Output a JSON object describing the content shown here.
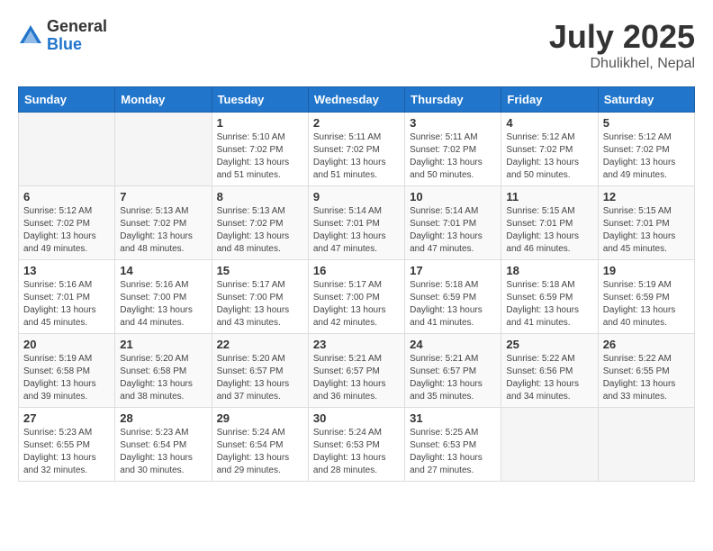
{
  "logo": {
    "general": "General",
    "blue": "Blue"
  },
  "title": "July 2025",
  "location": "Dhulikhel, Nepal",
  "days_header": [
    "Sunday",
    "Monday",
    "Tuesday",
    "Wednesday",
    "Thursday",
    "Friday",
    "Saturday"
  ],
  "weeks": [
    [
      {
        "day": "",
        "sunrise": "",
        "sunset": "",
        "daylight": ""
      },
      {
        "day": "",
        "sunrise": "",
        "sunset": "",
        "daylight": ""
      },
      {
        "day": "1",
        "sunrise": "Sunrise: 5:10 AM",
        "sunset": "Sunset: 7:02 PM",
        "daylight": "Daylight: 13 hours and 51 minutes."
      },
      {
        "day": "2",
        "sunrise": "Sunrise: 5:11 AM",
        "sunset": "Sunset: 7:02 PM",
        "daylight": "Daylight: 13 hours and 51 minutes."
      },
      {
        "day": "3",
        "sunrise": "Sunrise: 5:11 AM",
        "sunset": "Sunset: 7:02 PM",
        "daylight": "Daylight: 13 hours and 50 minutes."
      },
      {
        "day": "4",
        "sunrise": "Sunrise: 5:12 AM",
        "sunset": "Sunset: 7:02 PM",
        "daylight": "Daylight: 13 hours and 50 minutes."
      },
      {
        "day": "5",
        "sunrise": "Sunrise: 5:12 AM",
        "sunset": "Sunset: 7:02 PM",
        "daylight": "Daylight: 13 hours and 49 minutes."
      }
    ],
    [
      {
        "day": "6",
        "sunrise": "Sunrise: 5:12 AM",
        "sunset": "Sunset: 7:02 PM",
        "daylight": "Daylight: 13 hours and 49 minutes."
      },
      {
        "day": "7",
        "sunrise": "Sunrise: 5:13 AM",
        "sunset": "Sunset: 7:02 PM",
        "daylight": "Daylight: 13 hours and 48 minutes."
      },
      {
        "day": "8",
        "sunrise": "Sunrise: 5:13 AM",
        "sunset": "Sunset: 7:02 PM",
        "daylight": "Daylight: 13 hours and 48 minutes."
      },
      {
        "day": "9",
        "sunrise": "Sunrise: 5:14 AM",
        "sunset": "Sunset: 7:01 PM",
        "daylight": "Daylight: 13 hours and 47 minutes."
      },
      {
        "day": "10",
        "sunrise": "Sunrise: 5:14 AM",
        "sunset": "Sunset: 7:01 PM",
        "daylight": "Daylight: 13 hours and 47 minutes."
      },
      {
        "day": "11",
        "sunrise": "Sunrise: 5:15 AM",
        "sunset": "Sunset: 7:01 PM",
        "daylight": "Daylight: 13 hours and 46 minutes."
      },
      {
        "day": "12",
        "sunrise": "Sunrise: 5:15 AM",
        "sunset": "Sunset: 7:01 PM",
        "daylight": "Daylight: 13 hours and 45 minutes."
      }
    ],
    [
      {
        "day": "13",
        "sunrise": "Sunrise: 5:16 AM",
        "sunset": "Sunset: 7:01 PM",
        "daylight": "Daylight: 13 hours and 45 minutes."
      },
      {
        "day": "14",
        "sunrise": "Sunrise: 5:16 AM",
        "sunset": "Sunset: 7:00 PM",
        "daylight": "Daylight: 13 hours and 44 minutes."
      },
      {
        "day": "15",
        "sunrise": "Sunrise: 5:17 AM",
        "sunset": "Sunset: 7:00 PM",
        "daylight": "Daylight: 13 hours and 43 minutes."
      },
      {
        "day": "16",
        "sunrise": "Sunrise: 5:17 AM",
        "sunset": "Sunset: 7:00 PM",
        "daylight": "Daylight: 13 hours and 42 minutes."
      },
      {
        "day": "17",
        "sunrise": "Sunrise: 5:18 AM",
        "sunset": "Sunset: 6:59 PM",
        "daylight": "Daylight: 13 hours and 41 minutes."
      },
      {
        "day": "18",
        "sunrise": "Sunrise: 5:18 AM",
        "sunset": "Sunset: 6:59 PM",
        "daylight": "Daylight: 13 hours and 41 minutes."
      },
      {
        "day": "19",
        "sunrise": "Sunrise: 5:19 AM",
        "sunset": "Sunset: 6:59 PM",
        "daylight": "Daylight: 13 hours and 40 minutes."
      }
    ],
    [
      {
        "day": "20",
        "sunrise": "Sunrise: 5:19 AM",
        "sunset": "Sunset: 6:58 PM",
        "daylight": "Daylight: 13 hours and 39 minutes."
      },
      {
        "day": "21",
        "sunrise": "Sunrise: 5:20 AM",
        "sunset": "Sunset: 6:58 PM",
        "daylight": "Daylight: 13 hours and 38 minutes."
      },
      {
        "day": "22",
        "sunrise": "Sunrise: 5:20 AM",
        "sunset": "Sunset: 6:57 PM",
        "daylight": "Daylight: 13 hours and 37 minutes."
      },
      {
        "day": "23",
        "sunrise": "Sunrise: 5:21 AM",
        "sunset": "Sunset: 6:57 PM",
        "daylight": "Daylight: 13 hours and 36 minutes."
      },
      {
        "day": "24",
        "sunrise": "Sunrise: 5:21 AM",
        "sunset": "Sunset: 6:57 PM",
        "daylight": "Daylight: 13 hours and 35 minutes."
      },
      {
        "day": "25",
        "sunrise": "Sunrise: 5:22 AM",
        "sunset": "Sunset: 6:56 PM",
        "daylight": "Daylight: 13 hours and 34 minutes."
      },
      {
        "day": "26",
        "sunrise": "Sunrise: 5:22 AM",
        "sunset": "Sunset: 6:55 PM",
        "daylight": "Daylight: 13 hours and 33 minutes."
      }
    ],
    [
      {
        "day": "27",
        "sunrise": "Sunrise: 5:23 AM",
        "sunset": "Sunset: 6:55 PM",
        "daylight": "Daylight: 13 hours and 32 minutes."
      },
      {
        "day": "28",
        "sunrise": "Sunrise: 5:23 AM",
        "sunset": "Sunset: 6:54 PM",
        "daylight": "Daylight: 13 hours and 30 minutes."
      },
      {
        "day": "29",
        "sunrise": "Sunrise: 5:24 AM",
        "sunset": "Sunset: 6:54 PM",
        "daylight": "Daylight: 13 hours and 29 minutes."
      },
      {
        "day": "30",
        "sunrise": "Sunrise: 5:24 AM",
        "sunset": "Sunset: 6:53 PM",
        "daylight": "Daylight: 13 hours and 28 minutes."
      },
      {
        "day": "31",
        "sunrise": "Sunrise: 5:25 AM",
        "sunset": "Sunset: 6:53 PM",
        "daylight": "Daylight: 13 hours and 27 minutes."
      },
      {
        "day": "",
        "sunrise": "",
        "sunset": "",
        "daylight": ""
      },
      {
        "day": "",
        "sunrise": "",
        "sunset": "",
        "daylight": ""
      }
    ]
  ]
}
